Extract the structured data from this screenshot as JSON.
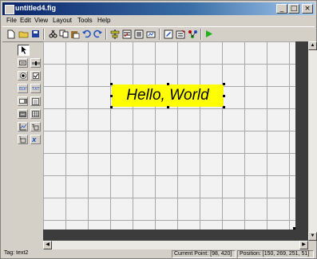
{
  "window": {
    "title": "untitled4.fig"
  },
  "menu": [
    "File",
    "Edit",
    "View",
    "Layout",
    "Tools",
    "Help"
  ],
  "toolbar": {
    "buttons": [
      "new-icon",
      "open-icon",
      "save-icon",
      "cut-icon",
      "copy-icon",
      "paste-icon",
      "undo-icon",
      "redo-icon",
      "align-icon",
      "menu-editor-icon",
      "tab-order-icon",
      "toolbar-editor-icon",
      "mfile-editor-icon",
      "property-inspector-icon",
      "object-browser-icon",
      "run-icon"
    ]
  },
  "palette": {
    "items": [
      "select-arrow-icon",
      "push-button-icon",
      "slider-icon",
      "radio-button-icon",
      "checkbox-icon",
      "edit-text-icon",
      "static-text-icon",
      "popup-menu-icon",
      "listbox-icon",
      "toggle-button-icon",
      "table-icon",
      "axes-icon",
      "panel-icon",
      "button-group-icon",
      "activex-icon"
    ]
  },
  "canvas": {
    "text_object": {
      "label": "Hello, World"
    }
  },
  "status": {
    "tag": "Tag: text2",
    "current_point": "Current Point:  [98, 420]",
    "position": "Position: [150, 269, 251, 51]"
  }
}
